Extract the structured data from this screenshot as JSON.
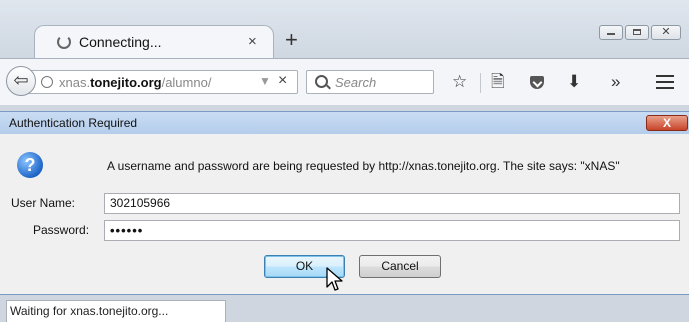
{
  "tab": {
    "title": "Connecting...",
    "close_glyph": "×",
    "new_tab_glyph": "+"
  },
  "window_controls": {
    "close_glyph": "✕"
  },
  "navbar": {
    "back_glyph": "⇦",
    "url": {
      "prefix": "xnas.",
      "host": "tonejito.org",
      "path": "/alumno/"
    },
    "url_dropdown_glyph": "▼",
    "stop_glyph": "×",
    "search_placeholder": "Search",
    "icons": {
      "bookmark_star": "☆",
      "reading_list": "🗎",
      "download": "⬇",
      "overflow": "»"
    }
  },
  "dialog": {
    "title": "Authentication Required",
    "close_glyph": "X",
    "info_glyph": "?",
    "message": "A username and password are being requested by http://xnas.tonejito.org. The site says: \"xNAS\"",
    "username_label": "User Name:",
    "username_value": "302105966",
    "password_label": "Password:",
    "password_value": "••••••",
    "ok_label": "OK",
    "cancel_label": "Cancel"
  },
  "status": {
    "text": "Waiting for xnas.tonejito.org..."
  },
  "colors": {
    "dialog_title_bg": "#b4cdeb",
    "close_button": "#c7442a",
    "ok_button_border": "#3c7fb1"
  }
}
